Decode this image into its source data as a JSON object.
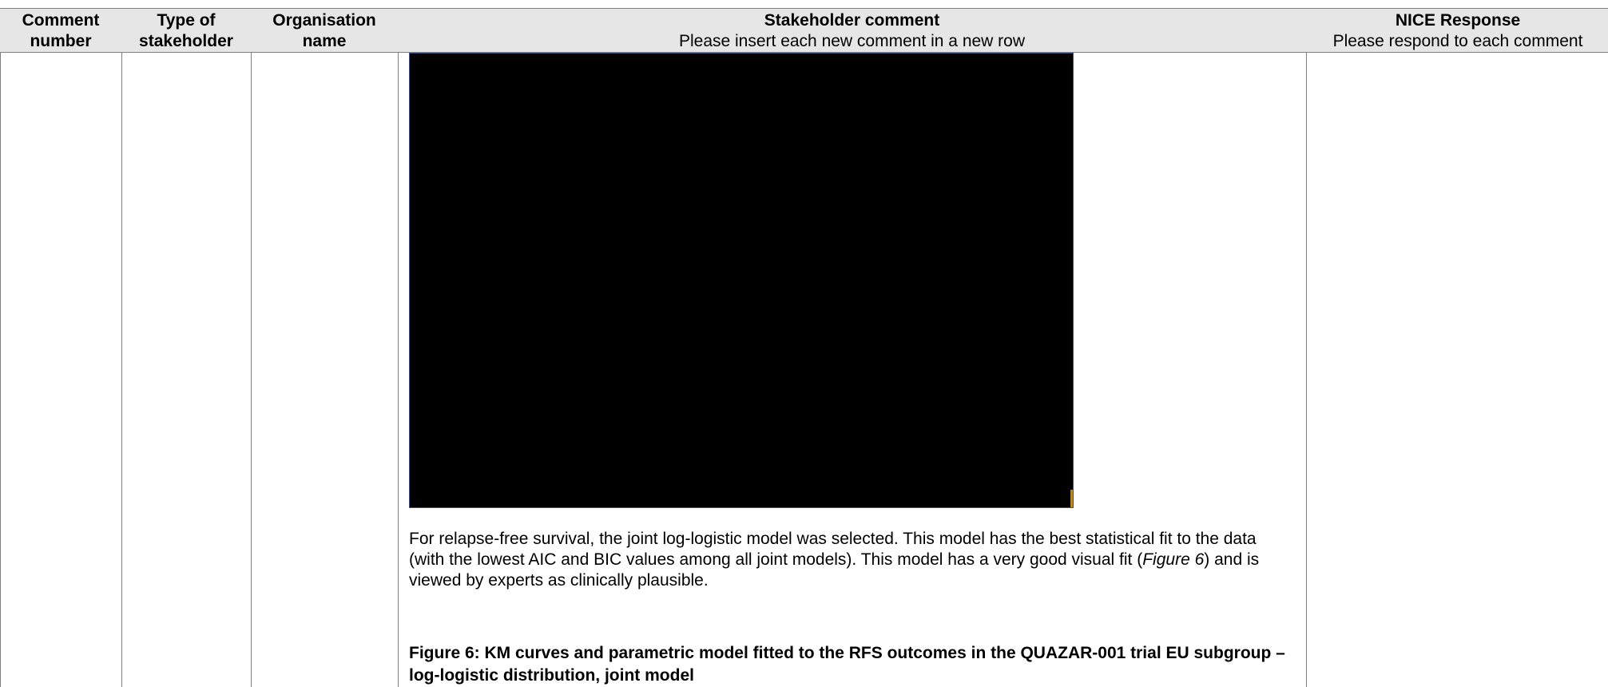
{
  "table": {
    "headers": {
      "comment_number": {
        "line1": "Comment",
        "line2": "number"
      },
      "type_of_stakeholder": {
        "line1": "Type of",
        "line2": "stakeholder"
      },
      "organisation_name": {
        "line1": "Organisation",
        "line2": "name"
      },
      "stakeholder_comment": {
        "title": "Stakeholder comment",
        "subtitle": "Please insert each new comment in a new row"
      },
      "nice_response": {
        "title": "NICE Response",
        "subtitle": "Please respond to each comment"
      }
    }
  },
  "body": {
    "paragraph_before": "For relapse-free survival, the joint log-logistic model was selected. This model has the best statistical fit to the data (with the lowest AIC and BIC values among all joint models). This model has a very good visual fit (",
    "paragraph_italic": "Figure 6",
    "paragraph_after": ") and is viewed by experts as clinically plausible.",
    "figure_caption": "Figure 6: KM curves and parametric model fitted to the RFS outcomes in the QUAZAR-001 trial EU subgroup – log-logistic distribution, joint model"
  },
  "colors": {
    "header_background": "#e6e6e6",
    "border": "#7f7f7f",
    "figure_fill": "#000000"
  }
}
